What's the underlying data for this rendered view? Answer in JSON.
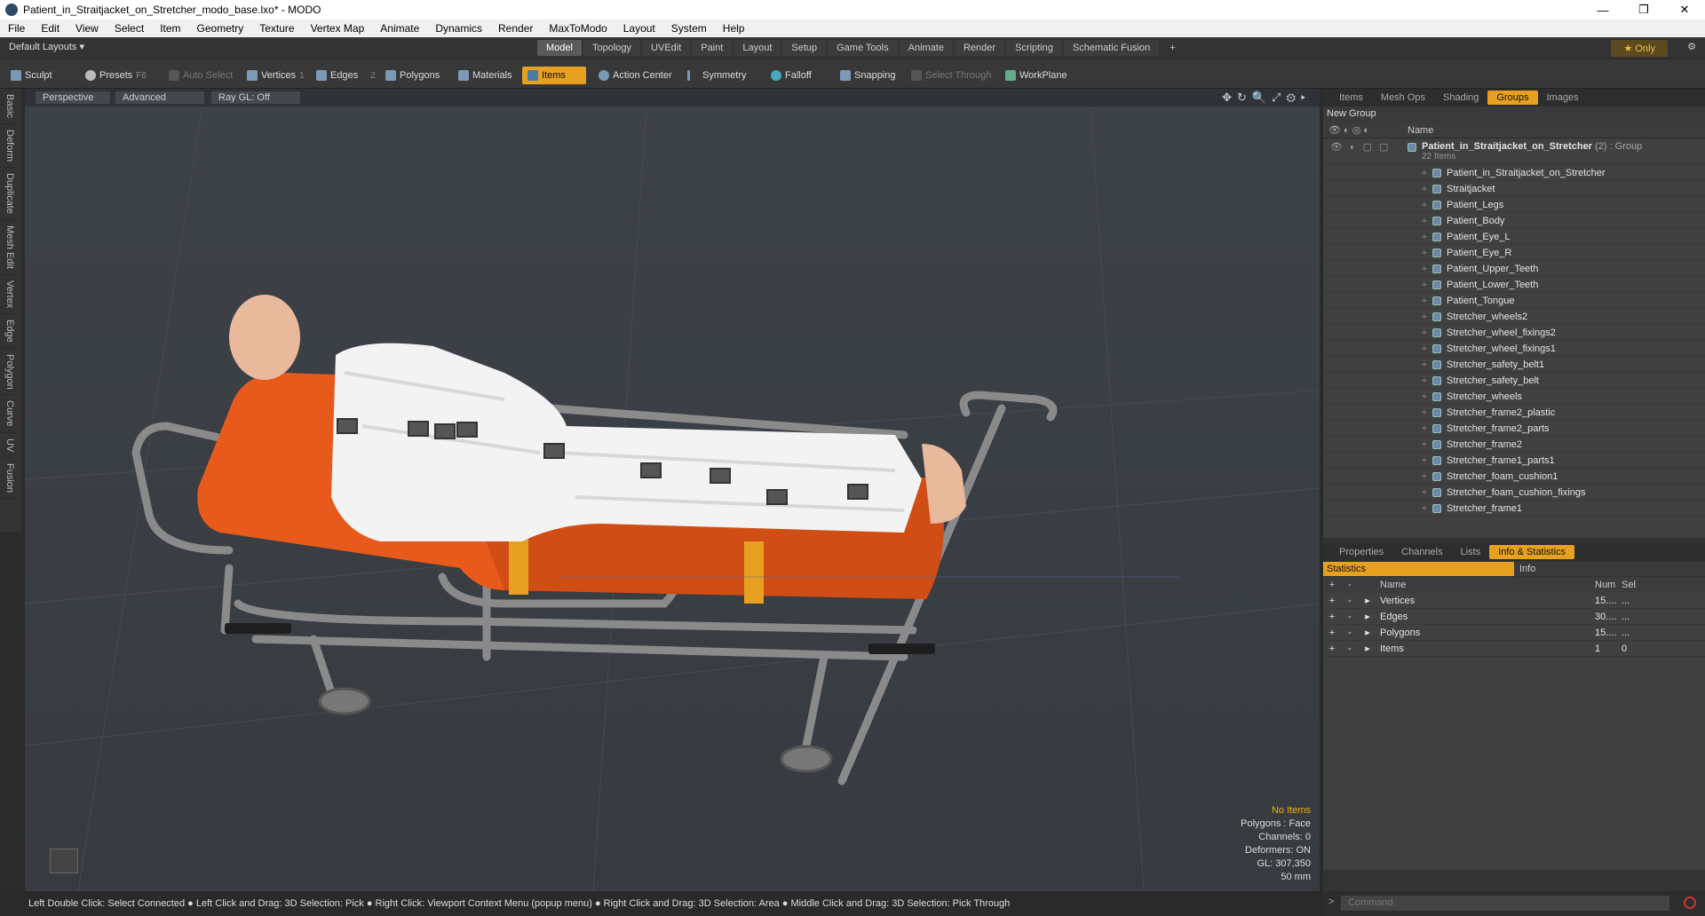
{
  "window": {
    "title": "Patient_in_Straitjacket_on_Stretcher_modo_base.lxo* - MODO",
    "minimize": "—",
    "maximize": "❐",
    "close": "✕"
  },
  "menu": [
    "File",
    "Edit",
    "View",
    "Select",
    "Item",
    "Geometry",
    "Texture",
    "Vertex Map",
    "Animate",
    "Dynamics",
    "Render",
    "MaxToModo",
    "Layout",
    "System",
    "Help"
  ],
  "tabbar": {
    "layouts": "Default Layouts ▾",
    "tabs": [
      "Model",
      "Topology",
      "UVEdit",
      "Paint",
      "Layout",
      "Setup",
      "Game Tools",
      "Animate",
      "Render",
      "Scripting",
      "Schematic Fusion"
    ],
    "active_tab": "Model",
    "add": "+",
    "only": "★ Only",
    "gear": "⚙"
  },
  "toolbar": {
    "sculpt": "Sculpt",
    "presets": "Presets",
    "presets_key": "F6",
    "auto_select": "Auto Select",
    "vertices": "Vertices",
    "vertices_key": "1",
    "edges": "Edges",
    "edges_key": "2",
    "polygons": "Polygons",
    "materials": "Materials",
    "items": "Items",
    "action_center": "Action Center",
    "symmetry": "Symmetry",
    "falloff": "Falloff",
    "snapping": "Snapping",
    "select_through": "Select Through",
    "workplane": "WorkPlane"
  },
  "left_tabs": [
    "Basic",
    "Deform",
    "Duplicate",
    "Mesh Edit",
    "Vertex",
    "Edge",
    "Polygon",
    "Curve",
    "UV",
    "Fusion"
  ],
  "viewport": {
    "perspective": "Perspective",
    "advanced": "Advanced",
    "raygl": "Ray GL: Off",
    "icons": "✥↻🔍⤢⚙▸",
    "info": {
      "no_items": "No Items",
      "polygons": "Polygons : Face",
      "channels": "Channels: 0",
      "deformers": "Deformers: ON",
      "gl": "GL: 307,350",
      "size": "50 mm"
    }
  },
  "items_panel": {
    "tabs": [
      "Items",
      "Mesh Ops",
      "Shading",
      "Groups",
      "Images"
    ],
    "active_tab": "Groups",
    "new_group": "New Group",
    "name_header": "Name",
    "group": {
      "name": "Patient_in_Straitjacket_on_Stretcher",
      "suffix": "(2) : Group",
      "count": "22 Items"
    },
    "items": [
      "Patient_in_Straitjacket_on_Stretcher",
      "Straitjacket",
      "Patient_Legs",
      "Patient_Body",
      "Patient_Eye_L",
      "Patient_Eye_R",
      "Patient_Upper_Teeth",
      "Patient_Lower_Teeth",
      "Patient_Tongue",
      "Stretcher_wheels2",
      "Stretcher_wheel_fixings2",
      "Stretcher_wheel_fixings1",
      "Stretcher_safety_belt1",
      "Stretcher_safety_belt",
      "Stretcher_wheels",
      "Stretcher_frame2_plastic",
      "Stretcher_frame2_parts",
      "Stretcher_frame2",
      "Stretcher_frame1_parts1",
      "Stretcher_foam_cushion1",
      "Stretcher_foam_cushion_fixings",
      "Stretcher_frame1"
    ]
  },
  "stats_panel": {
    "tabs": [
      "Properties",
      "Channels",
      "Lists",
      "Info & Statistics"
    ],
    "active_tab": "Info & Statistics",
    "statistics": "Statistics",
    "info": "Info",
    "headers": {
      "name": "Name",
      "num": "Num",
      "sel": "Sel"
    },
    "rows": [
      {
        "name": "Vertices",
        "num": "15....",
        "sel": "..."
      },
      {
        "name": "Edges",
        "num": "30....",
        "sel": "..."
      },
      {
        "name": "Polygons",
        "num": "15....",
        "sel": "..."
      },
      {
        "name": "Items",
        "num": "1",
        "sel": "0"
      }
    ]
  },
  "command": {
    "placeholder": "Command"
  },
  "statusbar": "Left Double Click: Select Connected ● Left Click and Drag: 3D Selection: Pick ● Right Click: Viewport Context Menu (popup menu) ● Right Click and Drag: 3D Selection: Area ● Middle Click and Drag: 3D Selection: Pick Through"
}
